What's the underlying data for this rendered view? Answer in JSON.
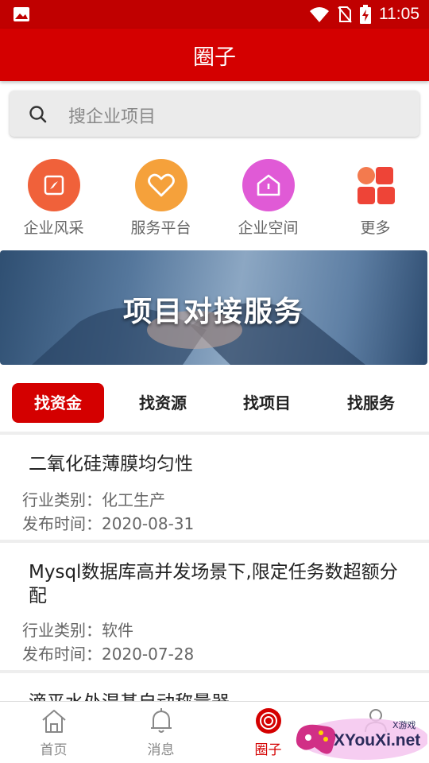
{
  "status_bar": {
    "time": "11:05"
  },
  "header": {
    "title": "圈子"
  },
  "search": {
    "placeholder": "搜企业项目"
  },
  "quick_links": [
    {
      "label": "企业风采",
      "icon": "compass-icon",
      "color": "#f0613a"
    },
    {
      "label": "服务平台",
      "icon": "heart-icon",
      "color": "#f5a13b"
    },
    {
      "label": "企业空间",
      "icon": "home-icon",
      "color": "#e05ad6"
    },
    {
      "label": "更多",
      "icon": "grid-icon",
      "color": "#f0613a"
    }
  ],
  "banner": {
    "text": "项目对接服务"
  },
  "tabs": [
    {
      "label": "找资金",
      "active": true
    },
    {
      "label": "找资源",
      "active": false
    },
    {
      "label": "找项目",
      "active": false
    },
    {
      "label": "找服务",
      "active": false
    }
  ],
  "list": [
    {
      "title": "二氧化硅薄膜均匀性",
      "category": "行业类别：化工生产",
      "date": "发布时间：2020-08-31"
    },
    {
      "title": "Mysql数据库高并发场景下,限定任务数超额分配",
      "category": "行业类别：软件",
      "date": "发布时间：2020-07-28"
    },
    {
      "title": "滴平水处混基自动称量器"
    }
  ],
  "bottom_nav": [
    {
      "label": "首页",
      "icon": "home-outline-icon",
      "active": false
    },
    {
      "label": "消息",
      "icon": "bell-icon",
      "active": false
    },
    {
      "label": "圈子",
      "icon": "circle-target-icon",
      "active": true
    }
  ],
  "watermark": {
    "text": "XYouXi.net",
    "small": "X游戏"
  },
  "colors": {
    "primary": "#d40000",
    "status_bar": "#c00000"
  }
}
